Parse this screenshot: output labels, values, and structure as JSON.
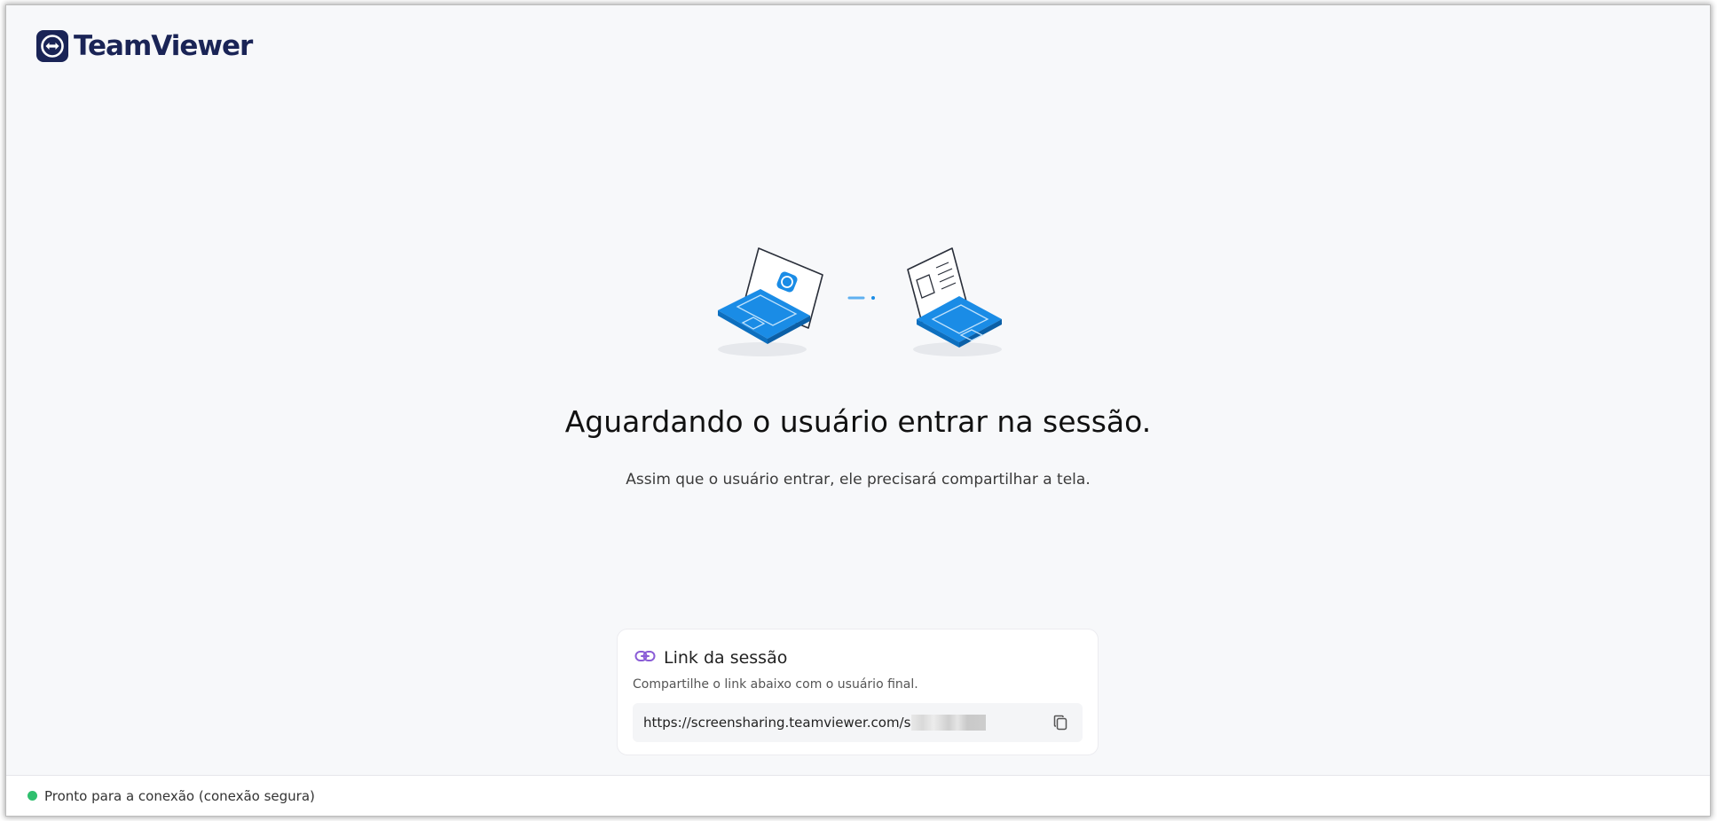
{
  "brand": {
    "name": "TeamViewer",
    "color": "#1a2456"
  },
  "main": {
    "headline": "Aguardando o usuário entrar na sessão.",
    "subline": "Assim que o usuário entrar, ele precisará compartilhar a tela."
  },
  "session_card": {
    "title": "Link da sessão",
    "icon": "link-icon",
    "description": "Compartilhe o link abaixo com o usuário final.",
    "link": "https://screensharing.teamviewer.com/s",
    "copy_icon": "copy-icon"
  },
  "status": {
    "text": "Pronto para a conexão (conexão segura)",
    "color": "#2fbf6e"
  },
  "colors": {
    "accent": "#1a8ce6",
    "background": "#f7f8fa"
  }
}
